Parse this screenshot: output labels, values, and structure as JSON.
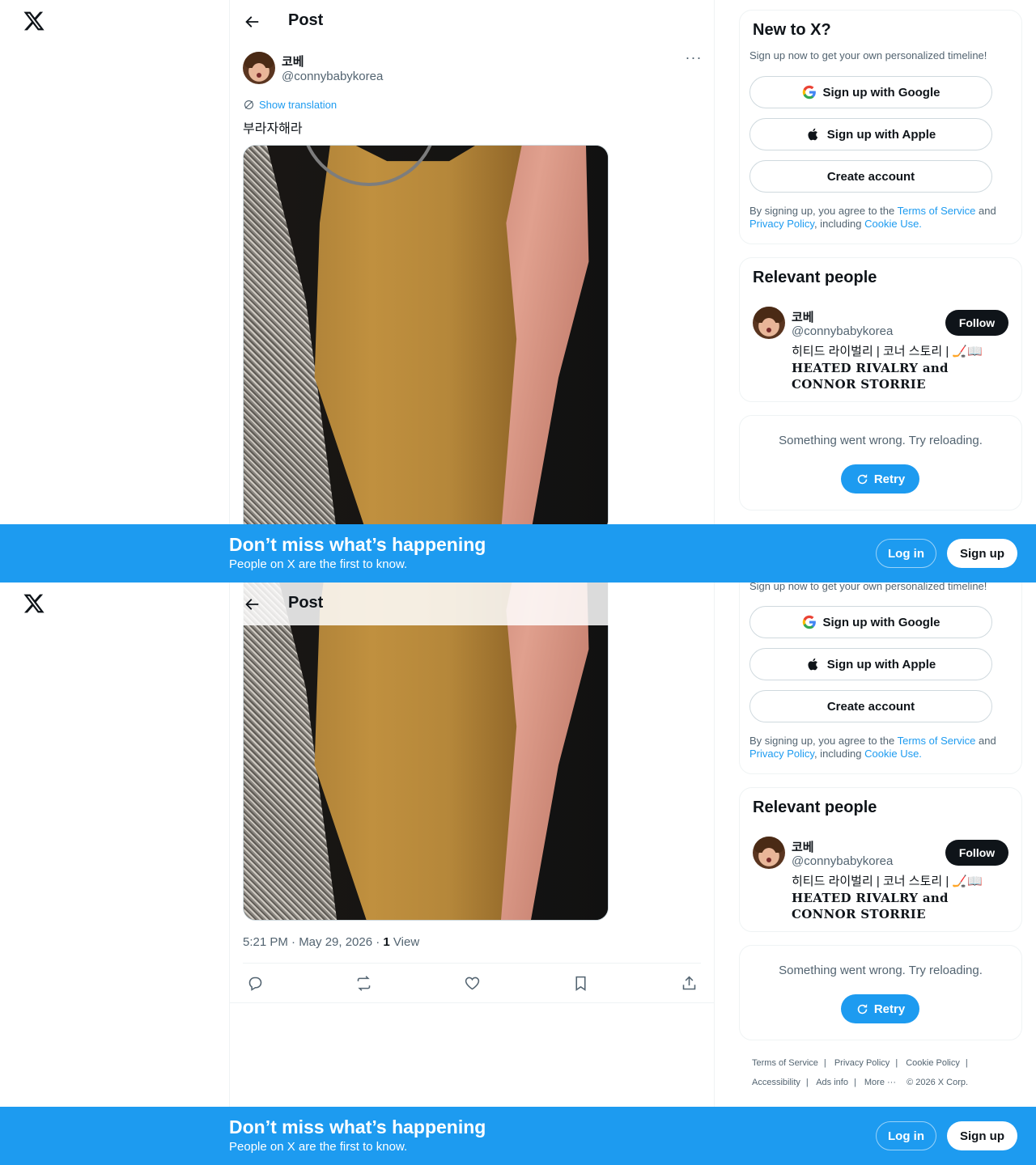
{
  "header": {
    "title": "Post"
  },
  "post": {
    "display_name": "코베",
    "handle": "@connybabykorea",
    "show_translation": "Show translation",
    "text": "부라자해라",
    "timestamp": "5:21 PM · May 29, 2026 · ",
    "views_count": "1",
    "views_label": " View"
  },
  "signup_card": {
    "title": "New to X?",
    "subtitle": "Sign up now to get your own personalized timeline!",
    "google_label": "Sign up with Google",
    "apple_label": "Sign up with Apple",
    "create_label": "Create account",
    "legal_prefix": "By signing up, you agree to the ",
    "terms": "Terms of Service",
    "and": " and ",
    "privacy": "Privacy Policy",
    "including": ", including ",
    "cookie": "Cookie Use."
  },
  "relevant_people": {
    "title": "Relevant people",
    "name": "코베",
    "handle": "@connybabykorea",
    "follow_label": "Follow",
    "bio_line1": "히티드 라이벌리 | 코너 스토리 | 🏒📖",
    "bio_line2": "HEATED RIVALRY and CONNOR STORRIE"
  },
  "error_card": {
    "message": "Something went wrong. Try reloading.",
    "retry_label": "Retry"
  },
  "footer": {
    "terms": "Terms of Service",
    "privacy": "Privacy Policy",
    "cookie": "Cookie Policy",
    "accessibility": "Accessibility",
    "ads": "Ads info",
    "more": "More ···",
    "copyright": "© 2026 X Corp."
  },
  "banner": {
    "title": "Don’t miss what’s happening",
    "subtitle": "People on X are the first to know.",
    "login_label": "Log in",
    "signup_label": "Sign up"
  },
  "colors": {
    "accent": "#1d9bf0",
    "text": "#0f1419",
    "muted": "#536471"
  }
}
